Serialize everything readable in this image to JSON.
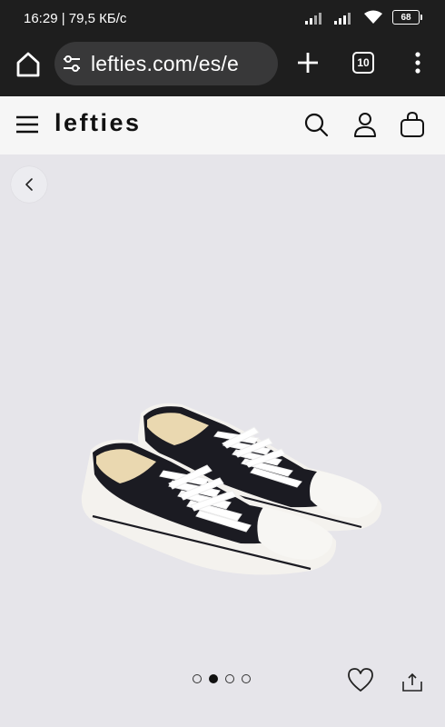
{
  "status_bar": {
    "time": "16:29",
    "separator": "|",
    "network_speed": "79,5 КБ/с",
    "battery_level": "68",
    "icons": [
      "signal-icon",
      "signal-icon",
      "wifi-icon",
      "battery-icon"
    ]
  },
  "browser": {
    "url": "lefties.com/es/e",
    "tab_count": "10",
    "icons": [
      "home-icon",
      "site-settings-icon",
      "new-tab-plus-icon",
      "tabs-icon",
      "more-vertical-icon"
    ]
  },
  "site_header": {
    "logo": "lefties",
    "icons": [
      "hamburger-menu-icon",
      "search-icon",
      "user-icon",
      "shopping-bag-icon"
    ]
  },
  "product": {
    "image_icon": "sneakers-image",
    "carousel": {
      "total": 4,
      "active_index": 1
    },
    "actions": {
      "icons": [
        "back-chevron-icon",
        "heart-icon",
        "share-icon"
      ]
    }
  },
  "colors": {
    "status_bg": "#1e1e1e",
    "url_bar_bg": "#383839",
    "header_bg": "#f6f6f6",
    "page_bg": "#e6e5ea",
    "text_dark": "#111111"
  }
}
